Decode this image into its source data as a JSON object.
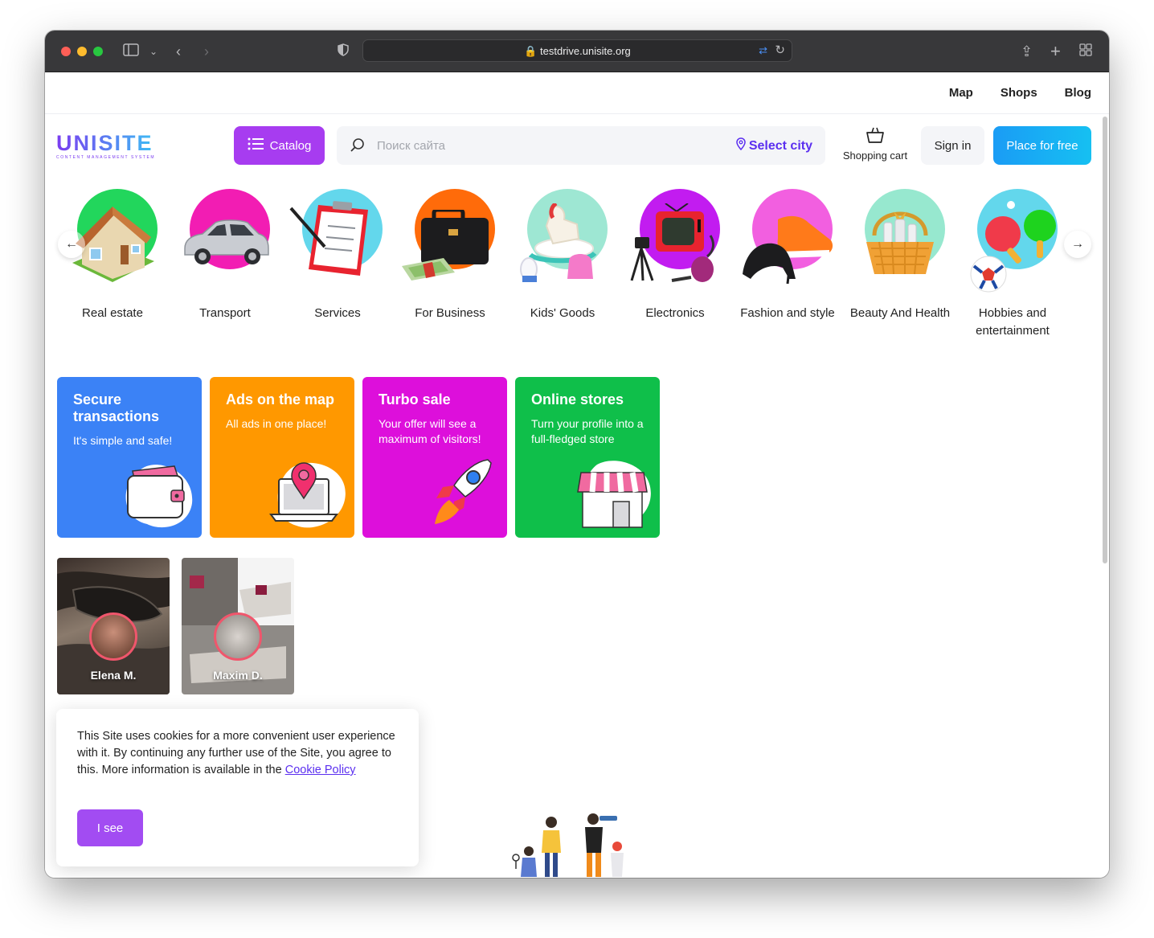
{
  "browser": {
    "url": "testdrive.unisite.org"
  },
  "topnav": [
    "Map",
    "Shops",
    "Blog"
  ],
  "header": {
    "logo_text": "UNISITE",
    "logo_sub": "CONTENT MANAGEMENT SYSTEM",
    "catalog_label": "Catalog",
    "search_placeholder": "Поиск сайта",
    "select_city": "Select city",
    "cart_label": "Shopping cart",
    "signin_label": "Sign in",
    "place_label": "Place for free"
  },
  "categories": [
    {
      "label": "Real estate",
      "color": "#22d65c"
    },
    {
      "label": "Transport",
      "color": "#f21db3"
    },
    {
      "label": "Services",
      "color": "#63d7ec"
    },
    {
      "label": "For Business",
      "color": "#ff6b0a"
    },
    {
      "label": "Kids' Goods",
      "color": "#9ee7d3"
    },
    {
      "label": "Electronics",
      "color": "#c21cf0"
    },
    {
      "label": "Fashion and style",
      "color": "#f25fe0"
    },
    {
      "label": "Beauty And Health",
      "color": "#97e8cf"
    },
    {
      "label": "Hobbies and entertainment",
      "color": "#63d7ec"
    }
  ],
  "promos": [
    {
      "title": "Secure transactions",
      "sub": "It's simple and safe!",
      "color": "#3b82f6"
    },
    {
      "title": "Ads on the map",
      "sub": "All ads in one place!",
      "color": "#ff9800"
    },
    {
      "title": "Turbo sale",
      "sub": "Your offer will see a maximum of visitors!",
      "color": "#dd0fdb"
    },
    {
      "title": "Online stores",
      "sub": "Turn your profile into a full-fledged store",
      "color": "#0fbf4a"
    }
  ],
  "stories": [
    {
      "name": "Elena M."
    },
    {
      "name": "Maxim D."
    }
  ],
  "cookie": {
    "text": "This Site uses cookies for a more convenient user experience with it. By continuing any further use of the Site, you agree to this. More information is available in the",
    "link": "Cookie Policy",
    "button": "I see"
  }
}
